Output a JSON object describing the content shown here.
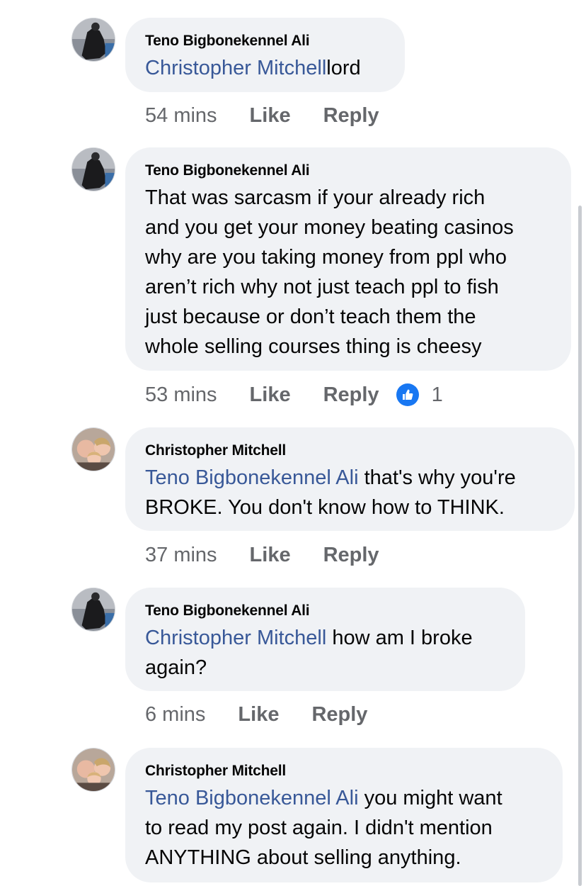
{
  "comments": [
    {
      "author": "Teno Bigbonekennel Ali",
      "mention": "Christopher Mitchell",
      "text": "lord",
      "time": "54 mins",
      "like": "Like",
      "reply": "Reply",
      "avatar": "teno-avatar"
    },
    {
      "author": "Teno Bigbonekennel Ali",
      "mention": "",
      "text_lines": [
        "That was sarcasm if your already rich",
        "and you get your money beating casinos",
        "why are you taking money from ppl who",
        "aren’t rich why not just teach ppl to fish",
        "just because or don’t teach them the",
        "whole selling courses thing is cheesy"
      ],
      "time": "53 mins",
      "like": "Like",
      "reply": "Reply",
      "reaction_icon": "thumbs-up-icon",
      "reaction_count": "1",
      "reaction_color": "#1877f2",
      "avatar": "teno-avatar"
    },
    {
      "author": "Christopher Mitchell",
      "mention": "Teno Bigbonekennel Ali",
      "text_lines": [
        "that's why you're",
        "BROKE. You don't know how to THINK."
      ],
      "time": "37 mins",
      "like": "Like",
      "reply": "Reply",
      "avatar": "christopher-avatar"
    },
    {
      "author": "Teno Bigbonekennel Ali",
      "mention": "Christopher Mitchell",
      "text_lines": [
        "how am I broke",
        "again?"
      ],
      "time": "6 mins",
      "like": "Like",
      "reply": "Reply",
      "avatar": "teno-avatar"
    },
    {
      "author": "Christopher Mitchell",
      "mention": "Teno Bigbonekennel Ali",
      "text_lines": [
        "you might want",
        "to read my post again. I didn't mention",
        "ANYTHING about selling anything."
      ],
      "time": "",
      "like": "",
      "reply": "",
      "avatar": "christopher-avatar"
    }
  ],
  "colors": {
    "bubble": "#f0f2f5",
    "mention": "#385898",
    "meta": "#65676b"
  }
}
